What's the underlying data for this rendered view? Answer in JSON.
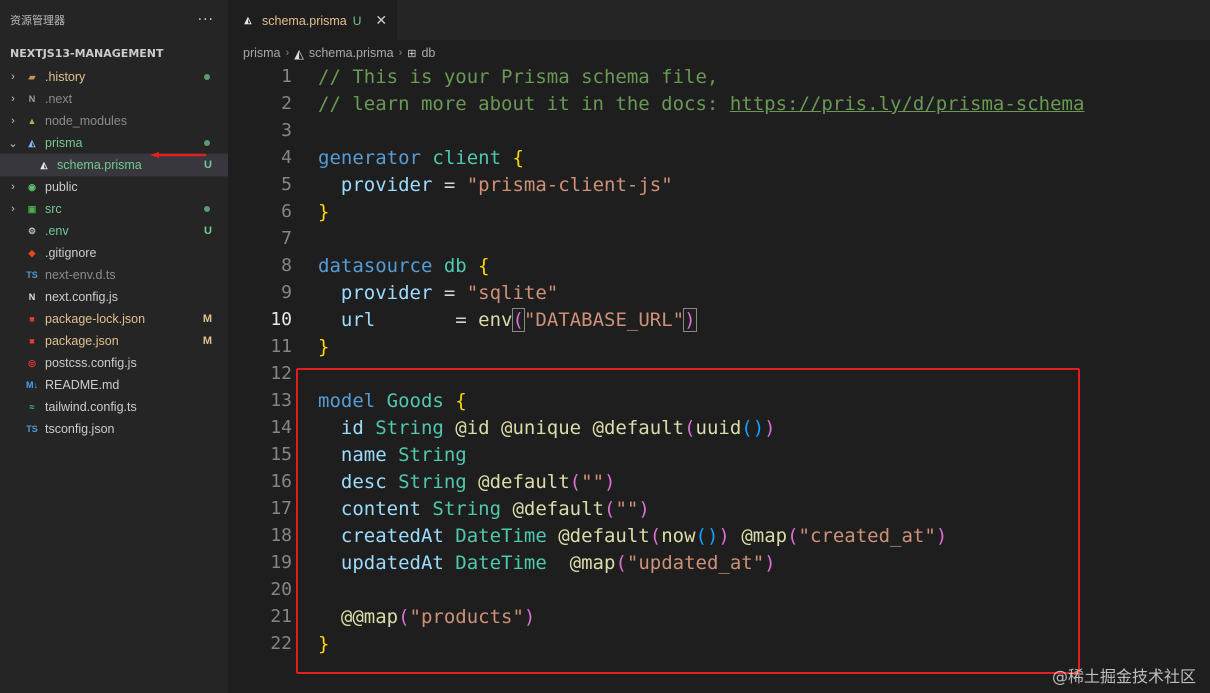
{
  "sidebar": {
    "title": "资源管理器",
    "more": "···",
    "project": "NEXTJS13-MANAGEMENT",
    "items": [
      {
        "label": ".history",
        "chev": "›",
        "icon": "folder-icon",
        "iconGlyph": "▰",
        "iconColor": "#c09553",
        "labelColor": "c-mod",
        "status": "dot"
      },
      {
        "label": ".next",
        "chev": "›",
        "icon": "next-folder-icon",
        "iconGlyph": "N",
        "iconColor": "#9e9e9e",
        "labelColor": "c-dim",
        "status": ""
      },
      {
        "label": "node_modules",
        "chev": "›",
        "icon": "node-folder-icon",
        "iconGlyph": "▲",
        "iconColor": "#8bc34a",
        "labelColor": "c-dim",
        "status": ""
      },
      {
        "label": "prisma",
        "chev": "⌄",
        "icon": "prisma-folder-icon",
        "iconGlyph": "◭",
        "iconColor": "#8ab4f8",
        "labelColor": "c-git",
        "status": "dot"
      },
      {
        "label": "schema.prisma",
        "chev": "",
        "icon": "prisma-file-icon",
        "iconGlyph": "◭",
        "iconColor": "#e8e8e8",
        "labelColor": "c-git",
        "status": "U",
        "indent": true,
        "active": true
      },
      {
        "label": "public",
        "chev": "›",
        "icon": "public-folder-icon",
        "iconGlyph": "◉",
        "iconColor": "#5ec26a",
        "labelColor": "c-plain",
        "status": ""
      },
      {
        "label": "src",
        "chev": "›",
        "icon": "src-folder-icon",
        "iconGlyph": "▣",
        "iconColor": "#4caf50",
        "labelColor": "c-git",
        "status": "dot"
      },
      {
        "label": ".env",
        "chev": "",
        "icon": "gear-icon",
        "iconGlyph": "⚙",
        "iconColor": "#b0bec5",
        "labelColor": "c-git",
        "status": "U"
      },
      {
        "label": ".gitignore",
        "chev": "",
        "icon": "git-icon",
        "iconGlyph": "◆",
        "iconColor": "#e64a19",
        "labelColor": "c-plain",
        "status": ""
      },
      {
        "label": "next-env.d.ts",
        "chev": "",
        "icon": "typescript-icon",
        "iconGlyph": "TS",
        "iconColor": "#4b9bd6",
        "labelColor": "c-dim",
        "status": ""
      },
      {
        "label": "next.config.js",
        "chev": "",
        "icon": "next-icon",
        "iconGlyph": "N",
        "iconColor": "#e0e0e0",
        "labelColor": "c-plain",
        "status": ""
      },
      {
        "label": "package-lock.json",
        "chev": "",
        "icon": "npm-icon",
        "iconGlyph": "■",
        "iconColor": "#e53935",
        "labelColor": "c-mod",
        "status": "M"
      },
      {
        "label": "package.json",
        "chev": "",
        "icon": "npm-icon",
        "iconGlyph": "■",
        "iconColor": "#e53935",
        "labelColor": "c-mod",
        "status": "M"
      },
      {
        "label": "postcss.config.js",
        "chev": "",
        "icon": "postcss-icon",
        "iconGlyph": "◎",
        "iconColor": "#e53935",
        "labelColor": "c-plain",
        "status": ""
      },
      {
        "label": "README.md",
        "chev": "",
        "icon": "markdown-icon",
        "iconGlyph": "M↓",
        "iconColor": "#42a5f5",
        "labelColor": "c-plain",
        "status": ""
      },
      {
        "label": "tailwind.config.ts",
        "chev": "",
        "icon": "tailwind-icon",
        "iconGlyph": "≈",
        "iconColor": "#4db6ac",
        "labelColor": "c-plain",
        "status": ""
      },
      {
        "label": "tsconfig.json",
        "chev": "",
        "icon": "tsconfig-icon",
        "iconGlyph": "TS",
        "iconColor": "#4b9bd6",
        "labelColor": "c-plain",
        "status": ""
      }
    ]
  },
  "editor": {
    "tab": {
      "name": "schema.prisma",
      "flag": "U",
      "close": "✕"
    },
    "breadcrumb": [
      "prisma",
      "schema.prisma",
      "db"
    ],
    "currentLine": 10,
    "lines": [
      [
        [
          "// This is your Prisma schema file,",
          "t-cm"
        ]
      ],
      [
        [
          "// learn more about it in the docs: ",
          "t-cm"
        ],
        [
          "https://pris.ly/d/prisma-schema",
          "t-url"
        ]
      ],
      [],
      [
        [
          "generator ",
          "t-kw"
        ],
        [
          "client ",
          "t-ty"
        ],
        [
          "{",
          "t-br1"
        ]
      ],
      [
        [
          "  provider ",
          "t-id"
        ],
        [
          "= ",
          "t-pl"
        ],
        [
          "\"prisma-client-js\"",
          "t-str"
        ]
      ],
      [
        [
          "}",
          "t-br1"
        ]
      ],
      [],
      [
        [
          "datasource ",
          "t-kw"
        ],
        [
          "db ",
          "t-ty"
        ],
        [
          "{",
          "t-br1"
        ]
      ],
      [
        [
          "  provider ",
          "t-id"
        ],
        [
          "= ",
          "t-pl"
        ],
        [
          "\"sqlite\"",
          "t-str"
        ]
      ],
      [
        [
          "  url      ",
          "t-id"
        ],
        [
          " = ",
          "t-pl"
        ],
        [
          "env",
          "t-fn"
        ],
        [
          "(",
          "t-br2 bm"
        ],
        [
          "\"DATABASE_URL\"",
          "t-str"
        ],
        [
          ")",
          "t-br2 bm"
        ]
      ],
      [
        [
          "}",
          "t-br1"
        ]
      ],
      [],
      [
        [
          "model ",
          "t-kw"
        ],
        [
          "Goods ",
          "t-ty"
        ],
        [
          "{",
          "t-br1"
        ]
      ],
      [
        [
          "  id ",
          "t-id"
        ],
        [
          "String ",
          "t-ty"
        ],
        [
          "@id @unique @default",
          "t-fn"
        ],
        [
          "(",
          "t-br2"
        ],
        [
          "uuid",
          "t-fn"
        ],
        [
          "()",
          "t-br3"
        ],
        [
          ")",
          "t-br2"
        ]
      ],
      [
        [
          "  name ",
          "t-id"
        ],
        [
          "String",
          "t-ty"
        ]
      ],
      [
        [
          "  desc ",
          "t-id"
        ],
        [
          "String ",
          "t-ty"
        ],
        [
          "@default",
          "t-fn"
        ],
        [
          "(",
          "t-br2"
        ],
        [
          "\"\"",
          "t-str"
        ],
        [
          ")",
          "t-br2"
        ]
      ],
      [
        [
          "  content ",
          "t-id"
        ],
        [
          "String ",
          "t-ty"
        ],
        [
          "@default",
          "t-fn"
        ],
        [
          "(",
          "t-br2"
        ],
        [
          "\"\"",
          "t-str"
        ],
        [
          ")",
          "t-br2"
        ]
      ],
      [
        [
          "  createdAt ",
          "t-id"
        ],
        [
          "DateTime ",
          "t-ty"
        ],
        [
          "@default",
          "t-fn"
        ],
        [
          "(",
          "t-br2"
        ],
        [
          "now",
          "t-fn"
        ],
        [
          "()",
          "t-br3"
        ],
        [
          ")",
          "t-br2"
        ],
        [
          " @map",
          "t-fn"
        ],
        [
          "(",
          "t-br2"
        ],
        [
          "\"created_at\"",
          "t-str"
        ],
        [
          ")",
          "t-br2"
        ]
      ],
      [
        [
          "  updatedAt ",
          "t-id"
        ],
        [
          "DateTime  ",
          "t-ty"
        ],
        [
          "@map",
          "t-fn"
        ],
        [
          "(",
          "t-br2"
        ],
        [
          "\"updated_at\"",
          "t-str"
        ],
        [
          ")",
          "t-br2"
        ]
      ],
      [],
      [
        [
          "  @@map",
          "t-fn"
        ],
        [
          "(",
          "t-br2"
        ],
        [
          "\"products\"",
          "t-str"
        ],
        [
          ")",
          "t-br2"
        ]
      ],
      [
        [
          "}",
          "t-br1"
        ]
      ]
    ]
  },
  "watermark": "@稀土掘金技术社区",
  "colors": {
    "annotation": "#e02020"
  }
}
